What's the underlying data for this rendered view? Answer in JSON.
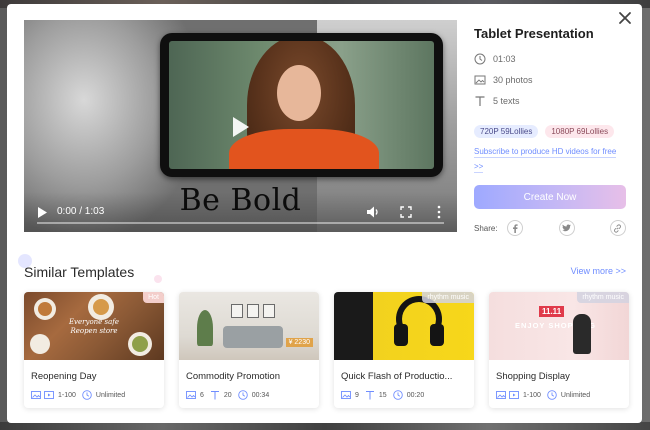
{
  "modal": {
    "title": "Tablet Presentation",
    "duration": "01:03",
    "photos": "30 photos",
    "texts": "5 texts",
    "badges": [
      "720P 59Lollies",
      "1080P 69Lollies"
    ],
    "subscribe_text": "Subscribe to produce HD videos for free",
    "subscribe_arrow": ">>",
    "create_button": "Create Now",
    "share_label": "Share:"
  },
  "video": {
    "caption": "Be Bold",
    "time": "0:00 / 1:03",
    "progress": 0
  },
  "similar": {
    "title": "Similar Templates",
    "view_more": "View more >>",
    "cards": [
      {
        "title": "Reopening Day",
        "tag": "Hot",
        "thumb_text_1": "Everyone safe",
        "thumb_text_2": "Reopen store",
        "count": "1-100",
        "duration": "Unlimited"
      },
      {
        "title": "Commodity Promotion",
        "tag": "",
        "thumb_text": "¥ 2230",
        "photos": "6",
        "texts": "20",
        "duration": "00:34"
      },
      {
        "title": "Quick Flash of Productio...",
        "tag": "rhythm music",
        "photos": "9",
        "texts": "15",
        "duration": "00:20"
      },
      {
        "title": "Shopping Display",
        "tag": "rhythm music",
        "thumb_sale": "11.11",
        "thumb_text": "ENJOY SHOPPING",
        "count": "1-100",
        "duration": "Unlimited"
      }
    ]
  },
  "colors": {
    "accent": "#6f8dff",
    "button_gradient_start": "#9ea9ff",
    "button_gradient_end": "#e7bfe8"
  }
}
